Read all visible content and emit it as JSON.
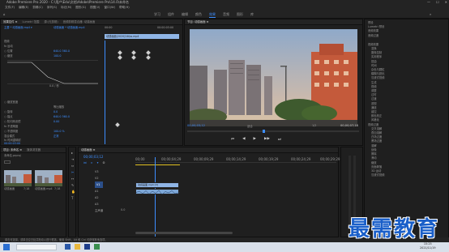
{
  "app": {
    "title": "Adobe Premiere Pro 2020 - C:\\用户\\Edu\\文档\\Adobe\\Premiere Pro\\14.0\\未命名"
  },
  "menu": [
    "文件(F)",
    "编辑(E)",
    "剪辑(C)",
    "序列(S)",
    "标记(M)",
    "图形(G)",
    "视图(V)",
    "窗口(W)",
    "帮助(H)"
  ],
  "workspaces": {
    "tabs": [
      "学习",
      "组件",
      "编辑",
      "颜色",
      "效果",
      "音频",
      "图形",
      "库"
    ],
    "active": "效果"
  },
  "effect_controls": {
    "tabs": [
      "效果控件 ≡",
      "Lumetri 范围",
      "源:(无剪辑)",
      "音频剪辑混合器: 动感画面"
    ],
    "source_label": "主要 * 动感画面.mp4 ▾",
    "sequence_label": "动感画面 * 动感画面.mp4",
    "timecodes": [
      "00:00",
      "00:00:05:00"
    ],
    "clip_label": "动感画面(2020)24fps.mp4",
    "rows": [
      {
        "label": "视频",
        "value": ""
      },
      {
        "label": "fx 运动",
        "value": ""
      },
      {
        "label": "○ 位置",
        "value": "640.0  360.0"
      },
      {
        "label": "○ 缩放",
        "value": "100.0"
      },
      {
        "label": "",
        "value": ""
      },
      {
        "label": "",
        "value": ""
      },
      {
        "label": "速度",
        "value": "0.0 / 秒"
      },
      {
        "label": "○ 缩放宽度",
        "value": "100.0"
      },
      {
        "label": "",
        "value": "等比缩放"
      },
      {
        "label": "○ 旋转",
        "value": "0.0"
      },
      {
        "label": "○ 锚点",
        "value": "640.0  360.0"
      },
      {
        "label": "○ 防闪烁滤镜",
        "value": "0.00"
      },
      {
        "label": "fx 不透明度",
        "value": ""
      },
      {
        "label": "○ 不透明度",
        "value": "100.0 %"
      },
      {
        "label": "混合模式",
        "value": "正常"
      },
      {
        "label": "fx 时间重映射",
        "value": ""
      },
      {
        "label": "音频",
        "value": ""
      }
    ],
    "bottom_timecode": "00:00:03:00"
  },
  "program": {
    "tab": "节目: 动感画面 ≡",
    "timecode_left": "00;00;03;12",
    "fit": "适合",
    "fraction": "1/2",
    "timecode_right": "00;00;07;18",
    "controls": [
      "⏮",
      "◀",
      "▶",
      "▶▶",
      "⏭"
    ]
  },
  "project": {
    "tabs": [
      "项目: 未命名 ≡",
      "媒体浏览器"
    ],
    "name": "未命名.prproj",
    "items": [
      {
        "name": "动感画面",
        "duration": "7;18"
      },
      {
        "name": "动感画面.mp4",
        "duration": "7;18"
      }
    ]
  },
  "timeline": {
    "tab": "动感画面 ≡",
    "timecode": "00;00;03;12",
    "ruler": [
      "00;00",
      "00;00;04;29",
      "00;00;09;29",
      "00;00;14;29",
      "00;00;19;29",
      "00;00;24;29",
      "00;00;29;29"
    ],
    "tracks": [
      "V3",
      "V2",
      "V1",
      "A1",
      "A2",
      "A3",
      "主声道"
    ],
    "master_value": "0.0",
    "clip_label": "动感画面.mp4 [V]"
  },
  "effects": {
    "sections": [
      "预设",
      "Lumetri 预设",
      "音频效果",
      "音频过渡",
      "视频效果",
      "视频过渡"
    ],
    "items": [
      "变换",
      "图像控制",
      "实用程序",
      "扭曲",
      "时间",
      "杂色与颗粒",
      "模糊与锐化",
      "沉浸式视频",
      "生成",
      "视频",
      "调整",
      "过时",
      "过渡",
      "透视",
      "通道",
      "键控",
      "颜色校正",
      "风格化",
      "交叉溶解",
      "叠加溶解",
      "白场过渡",
      "黑场过渡",
      "溶解",
      "划像",
      "擦除",
      "滑动",
      "缩放",
      "页面剥落",
      "3D 运动",
      "沉浸式视频"
    ]
  },
  "status_bar": "单击可选择，或单击空白处并拖动以进行框选。使用 Shift、Alt 和 Ctrl 可获得其他选项。",
  "watermark": "最需教育",
  "taskbar": {
    "time": "15:25",
    "date": "2021/11/19"
  },
  "colors": {
    "accent": "#3d8eff",
    "clip": "#8fb5e6",
    "watermark": "#1a5fc9"
  }
}
